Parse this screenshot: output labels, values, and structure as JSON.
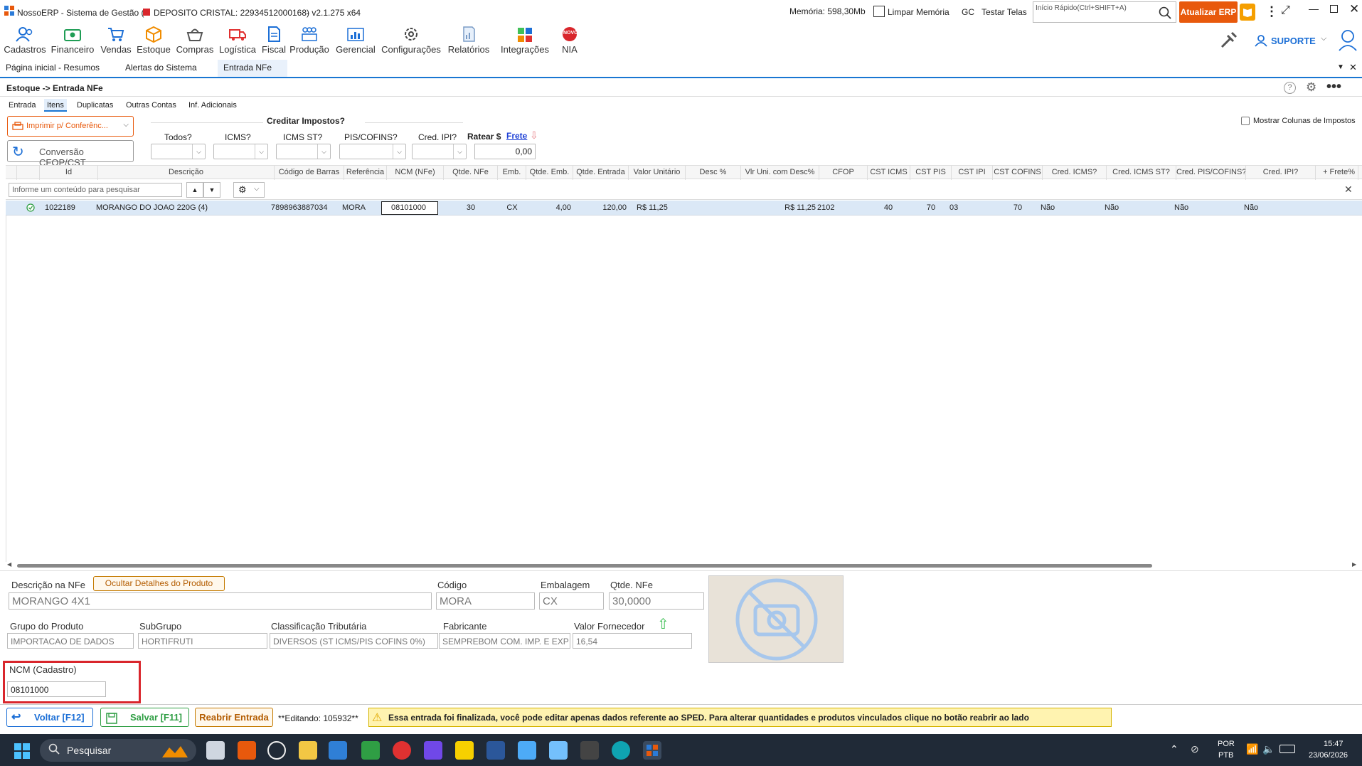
{
  "window": {
    "app_name": "NossoERP - Sistema de Gestão (",
    "company": "DEPOSITO CRISTAL: 22934512000168)",
    "version": "- v2.1.275 x64",
    "memory": "Memória: 598,30Mb",
    "clear_memory": "Limpar Memória",
    "gc": "GC",
    "test_screens": "Testar Telas",
    "quick_search_placeholder": "Início Rápido(Ctrl+SHIFT+A)",
    "update_button": "Atualizar ERP",
    "support": "SUPORTE"
  },
  "toolbar": {
    "items": [
      {
        "label": "Cadastros",
        "icon": "people-icon"
      },
      {
        "label": "Financeiro",
        "icon": "money-icon"
      },
      {
        "label": "Vendas",
        "icon": "cart-icon"
      },
      {
        "label": "Estoque",
        "icon": "box-icon"
      },
      {
        "label": "Compras",
        "icon": "basket-icon"
      },
      {
        "label": "Logística",
        "icon": "truck-icon"
      },
      {
        "label": "Fiscal",
        "icon": "document-icon"
      },
      {
        "label": "Produção",
        "icon": "factory-icon"
      },
      {
        "label": "Gerencial",
        "icon": "chart-icon"
      },
      {
        "label": "Configurações",
        "icon": "gear-icon"
      },
      {
        "label": "Relatórios",
        "icon": "report-icon"
      },
      {
        "label": "Integrações",
        "icon": "integration-icon"
      },
      {
        "label": "NIA",
        "icon": "nia-icon"
      }
    ],
    "nia_badge": "NOVO"
  },
  "doc_tabs": [
    "Página inicial - Resumos",
    "Alertas do Sistema",
    "Entrada NFe"
  ],
  "breadcrumb": "Estoque -> Entrada NFe",
  "sub_tabs": [
    "Entrada",
    "Itens",
    "Duplicatas",
    "Outras Contas",
    "Inf. Adicionais"
  ],
  "controls": {
    "print_button": "Imprimir p/ Conferênc...",
    "convert_button": "Conversão CFOP/CST",
    "credit_taxes_title": "Creditar Impostos?",
    "filters": [
      "Todos?",
      "ICMS?",
      "ICMS ST?",
      "PIS/COFINS?",
      "Cred. IPI?"
    ],
    "prorate_label": "Ratear $",
    "freight_link": "Frete",
    "prorate_value": "0,00",
    "show_tax_columns": "Mostrar Colunas de Impostos"
  },
  "grid": {
    "columns": [
      "Id",
      "Descrição",
      "Código de Barras",
      "Referência",
      "NCM (NFe)",
      "Qtde. NFe",
      "Emb.",
      "Qtde. Emb.",
      "Qtde. Entrada",
      "Valor Unitário",
      "Desc %",
      "Vlr Uni. com Desc%",
      "CFOP",
      "CST ICMS",
      "CST PIS",
      "CST IPI",
      "CST COFINS",
      "Cred. ICMS?",
      "Cred. ICMS ST?",
      "Cred. PIS/COFINS?",
      "Cred. IPI?",
      "+ Frete%"
    ],
    "search_placeholder": "Informe um conteúdo para pesquisar",
    "rows": [
      {
        "id": "1022189",
        "descricao": "MORANGO DO JOAO 220G (4)",
        "codigo_barras": "7898963887034",
        "referencia": "MORA",
        "ncm": "08101000",
        "qtde_nfe": "30",
        "emb": "CX",
        "qtde_emb": "4,00",
        "qtde_entrada": "120,00",
        "valor_unitario": "R$ 11,25",
        "desc": "",
        "vlr_desc": "R$ 11,25",
        "cfop": "2102",
        "cst_icms": "40",
        "cst_pis": "70",
        "cst_ipi": "03",
        "cst_cofins": "70",
        "cred_icms": "Não",
        "cred_icms_st": "Não",
        "cred_pis_cofins": "Não",
        "cred_ipi": "Não"
      }
    ]
  },
  "detail": {
    "desc_nfe_label": "Descrição na NFe",
    "hide_details_button": "Ocultar Detalhes do Produto",
    "desc_nfe_value": "MORANGO 4X1",
    "codigo_label": "Código",
    "codigo_value": "MORA",
    "embalagem_label": "Embalagem",
    "embalagem_value": "CX",
    "qtde_nfe_label": "Qtde. NFe",
    "qtde_nfe_value": "30,0000",
    "grupo_label": "Grupo do Produto",
    "grupo_value": "IMPORTACAO DE DADOS",
    "subgrupo_label": "SubGrupo",
    "subgrupo_value": "HORTIFRUTI",
    "classif_label": "Classificação Tributária",
    "classif_value": "DIVERSOS (ST ICMS/PIS COFINS 0%)",
    "fabricante_label": "Fabricante",
    "fabricante_value": "SEMPREBOM COM. IMP. E EXP",
    "valor_fornecedor_label": "Valor Fornecedor",
    "valor_fornecedor_value": "16,54",
    "ncm_label": "NCM (Cadastro)",
    "ncm_value": "08101000"
  },
  "bottom": {
    "back_button": "Voltar [F12]",
    "save_button": "Salvar [F11]",
    "reopen_button": "Reabrir Entrada",
    "editing": "**Editando: 105932**",
    "warning": "Essa entrada foi finalizada, você pode editar apenas dados referente ao SPED. Para alterar quantidades e produtos vinculados clique no botão reabrir ao lado"
  },
  "taskbar": {
    "search": "Pesquisar",
    "lang1": "POR",
    "lang2": "PTB",
    "time": "15:47",
    "date": "23/06/2026"
  },
  "colors": {
    "accent": "#1976d2",
    "update_orange": "#e8590c",
    "selected_row": "#dbe8f6",
    "warning_bg": "#fff3b0",
    "highlight_red": "#d9262c"
  }
}
